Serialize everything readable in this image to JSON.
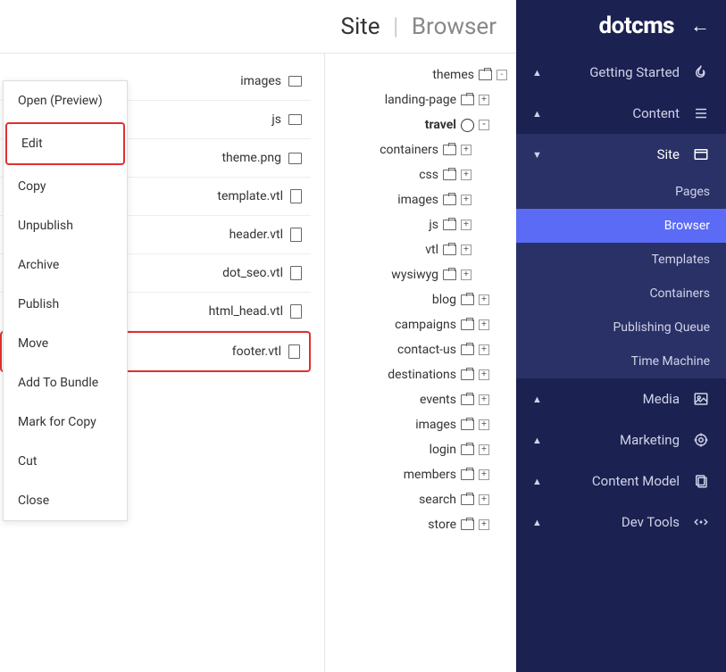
{
  "logo": {
    "dot": "dot",
    "cms": "cms"
  },
  "sidebar": {
    "sections": [
      {
        "label": "Getting Started",
        "expanded": false
      },
      {
        "label": "Content",
        "expanded": false
      },
      {
        "label": "Site",
        "expanded": true
      },
      {
        "label": "Media",
        "expanded": false
      },
      {
        "label": "Marketing",
        "expanded": false
      },
      {
        "label": "Content Model",
        "expanded": false
      },
      {
        "label": "Dev Tools",
        "expanded": false
      }
    ],
    "site_subitems": [
      {
        "label": "Pages"
      },
      {
        "label": "Browser",
        "active": true
      },
      {
        "label": "Templates"
      },
      {
        "label": "Containers"
      },
      {
        "label": "Publishing Queue"
      },
      {
        "label": "Time Machine"
      }
    ]
  },
  "breadcrumb": {
    "root": "Site",
    "current": "Browser"
  },
  "tree": [
    {
      "label": "themes",
      "indent": 0,
      "expand": "-"
    },
    {
      "label": "landing-page",
      "indent": 1,
      "expand": "+"
    },
    {
      "label": "travel",
      "indent": 1,
      "expand": "-",
      "bold": true,
      "globe": true
    },
    {
      "label": "containers",
      "indent": 2,
      "expand": "+"
    },
    {
      "label": "css",
      "indent": 2,
      "expand": "+"
    },
    {
      "label": "images",
      "indent": 2,
      "expand": "+"
    },
    {
      "label": "js",
      "indent": 2,
      "expand": "+"
    },
    {
      "label": "vtl",
      "indent": 2,
      "expand": "+"
    },
    {
      "label": "wysiwyg",
      "indent": 2,
      "expand": "+"
    },
    {
      "label": "blog",
      "indent": 1,
      "expand": "+"
    },
    {
      "label": "campaigns",
      "indent": 1,
      "expand": "+"
    },
    {
      "label": "contact-us",
      "indent": 1,
      "expand": "+"
    },
    {
      "label": "destinations",
      "indent": 1,
      "expand": "+"
    },
    {
      "label": "events",
      "indent": 1,
      "expand": "+"
    },
    {
      "label": "images",
      "indent": 1,
      "expand": "+"
    },
    {
      "label": "login",
      "indent": 1,
      "expand": "+"
    },
    {
      "label": "members",
      "indent": 1,
      "expand": "+"
    },
    {
      "label": "search",
      "indent": 1,
      "expand": "+"
    },
    {
      "label": "store",
      "indent": 1,
      "expand": "+"
    }
  ],
  "files": [
    {
      "label": "images",
      "type": "folder"
    },
    {
      "label": "js",
      "type": "folder"
    },
    {
      "label": "theme.png",
      "type": "image"
    },
    {
      "label": "template.vtl",
      "type": "doc"
    },
    {
      "label": "header.vtl",
      "type": "doc"
    },
    {
      "label": "dot_seo.vtl",
      "type": "doc"
    },
    {
      "label": "html_head.vtl",
      "type": "doc"
    },
    {
      "label": "footer.vtl",
      "type": "doc",
      "highlighted": true
    }
  ],
  "context_menu": [
    {
      "label": "Open (Preview)"
    },
    {
      "label": "Edit",
      "highlighted": true
    },
    {
      "label": "Copy"
    },
    {
      "label": "Unpublish"
    },
    {
      "label": "Archive"
    },
    {
      "label": "Publish"
    },
    {
      "label": "Move"
    },
    {
      "label": "Add To Bundle"
    },
    {
      "label": "Mark for Copy"
    },
    {
      "label": "Cut"
    },
    {
      "label": "Close"
    }
  ]
}
